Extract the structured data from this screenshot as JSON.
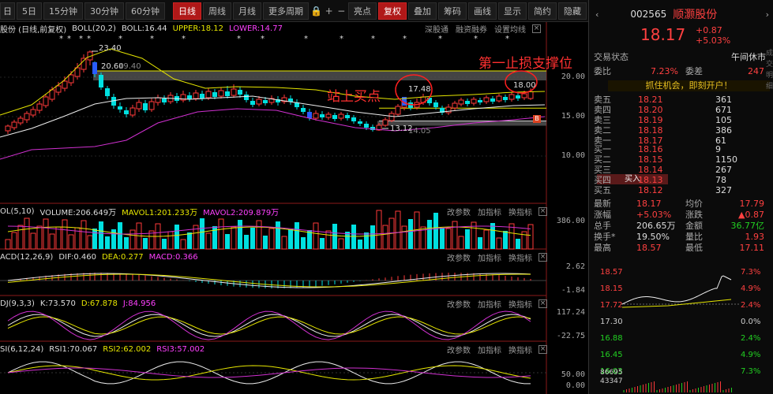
{
  "toolbar": {
    "items": [
      "5日",
      "15分钟",
      "30分钟",
      "60分钟",
      "日线",
      "周线",
      "月线",
      "更多周期"
    ],
    "tools": [
      "亮点",
      "复权",
      "叠加",
      "筹码",
      "画线",
      "显示",
      "简约",
      "隐藏"
    ],
    "prefix": "日"
  },
  "main": {
    "title": "股份 (日线,前复权)",
    "boll": "BOLL(20,2)",
    "boll_val": "BOLL:16.44",
    "upper": "UPPER:18.12",
    "lower": "LOWER:14.77",
    "btns": [
      "深股通",
      "融资融券",
      "设置均线"
    ],
    "high_label": "23.40",
    "low_label": "13.12",
    "label_2060": "20.60",
    "label_1940": "19.40",
    "label_1405": "14.05",
    "tag_1748": "17.48",
    "tag_1800": "18.00",
    "annot1": "第一止损支撑位",
    "annot2": "站上买点",
    "b_marker": "B",
    "yaxis": [
      "20.00",
      "15.00",
      "10.00"
    ]
  },
  "vol": {
    "title": "OL(5,10)",
    "v": "VOLUME:206.649万",
    "m1": "MAVOL1:201.233万",
    "m2": "MAVOL2:209.879万",
    "btns": [
      "改参数",
      "加指标",
      "换指标"
    ],
    "yaxis": [
      "386.00"
    ]
  },
  "macd": {
    "title": "ACD(12,26,9)",
    "dif": "DIF:0.460",
    "dea": "DEA:0.277",
    "m": "MACD:0.366",
    "btns": [
      "改参数",
      "加指标",
      "换指标"
    ],
    "yaxis": [
      "2.62",
      "-1.84"
    ]
  },
  "kdj": {
    "title": "DJ(9,3,3)",
    "k": "K:73.570",
    "d": "D:67.878",
    "j": "J:84.956",
    "btns": [
      "改参数",
      "加指标",
      "换指标"
    ],
    "yaxis": [
      "117.24",
      "-22.75"
    ]
  },
  "rsi": {
    "title": "SI(6,12,24)",
    "r1": "RSI1:70.067",
    "r2": "RSI2:62.002",
    "r3": "RSI3:57.002",
    "btns": [
      "改参数",
      "加指标",
      "换指标"
    ],
    "yaxis": [
      "50.00",
      "0.00"
    ]
  },
  "quote": {
    "code": "002565",
    "name": "顺灏股份",
    "price": "18.17",
    "change": "+0.87",
    "pct": "+5.03%",
    "status_label": "交易状态",
    "status": "午间休市",
    "weibi_label": "委比",
    "weibi": "7.23%",
    "weicha_label": "委差",
    "weicha": "247",
    "banner": "抓住机会，即刻开户！",
    "sell": [
      {
        "l": "卖五",
        "p": "18.21",
        "v": "361"
      },
      {
        "l": "卖四",
        "p": "18.20",
        "v": "671"
      },
      {
        "l": "卖三",
        "p": "18.19",
        "v": "105"
      },
      {
        "l": "卖二",
        "p": "18.18",
        "v": "386"
      },
      {
        "l": "卖一",
        "p": "18.17",
        "v": "61"
      }
    ],
    "buy": [
      {
        "l": "买一",
        "p": "18.16",
        "v": "9"
      },
      {
        "l": "买二",
        "p": "18.15",
        "v": "1150"
      },
      {
        "l": "买三",
        "p": "18.14",
        "v": "267"
      },
      {
        "l": "买四",
        "p": "18.13",
        "v": "78"
      },
      {
        "l": "买五",
        "p": "18.12",
        "v": "327"
      }
    ],
    "buy_btn": "买入",
    "stats": [
      {
        "l1": "最新",
        "v1": "18.17",
        "l2": "均价",
        "v2": "17.79"
      },
      {
        "l1": "涨幅",
        "v1": "+5.03%",
        "l2": "涨跌",
        "v2": "▲0.87"
      },
      {
        "l1": "总手",
        "v1": "206.65万",
        "l2": "金额",
        "v2": "36.77亿"
      },
      {
        "l1": "换手*",
        "v1": "19.50%",
        "l2": "量比",
        "v2": "1.93"
      },
      {
        "l1": "最高",
        "v1": "18.57",
        "l2": "最低",
        "v2": "17.11"
      }
    ],
    "mini": {
      "p": [
        "18.57",
        "18.15",
        "17.72",
        "17.30",
        "16.88",
        "16.45",
        "16.03"
      ],
      "pct": [
        "7.3%",
        "4.9%",
        "2.4%",
        "0.0%",
        "2.4%",
        "4.9%",
        "7.3%"
      ],
      "vol": [
        "86695",
        "43347"
      ]
    },
    "side": [
      "成",
      "交",
      "明",
      "细"
    ]
  }
}
